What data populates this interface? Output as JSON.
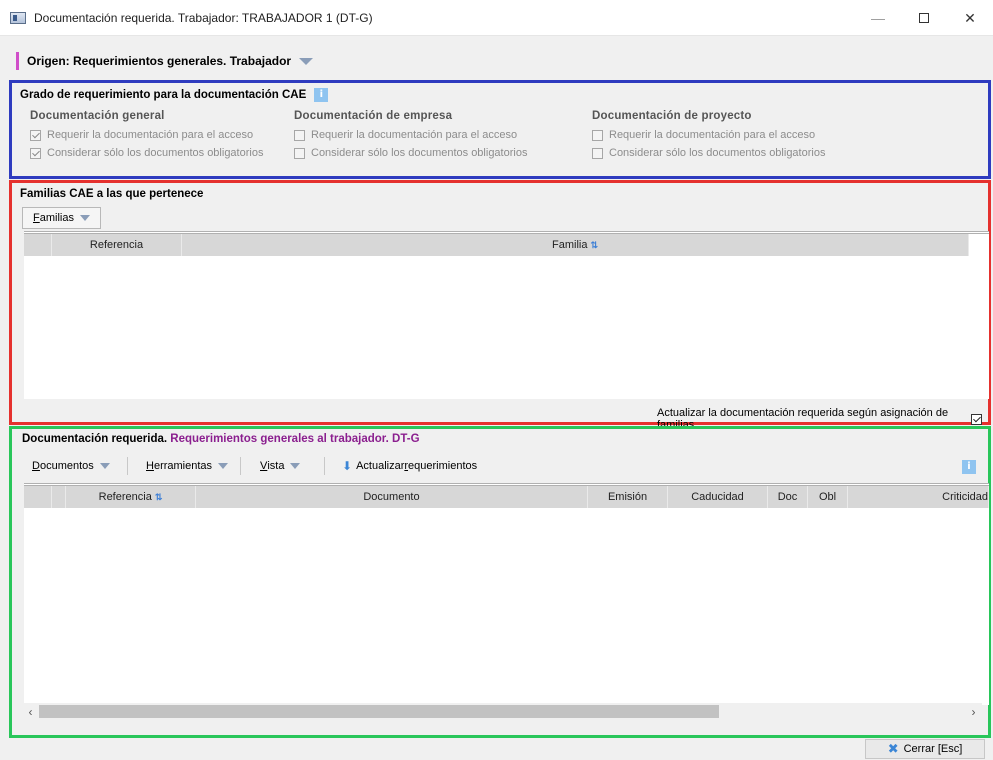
{
  "window": {
    "title": "Documentación requerida. Trabajador: TRABAJADOR 1 (DT-G)",
    "minimize": "—",
    "close": "✕"
  },
  "origin": {
    "label": "Origen: Requerimientos generales. Trabajador"
  },
  "requirement": {
    "title": "Grado de requerimiento para la documentación CAE",
    "info": "i",
    "columns": [
      {
        "heading": "Documentación general",
        "require_access": "Requerir la documentación para el acceso",
        "only_mandatory": "Considerar sólo los documentos obligatorios",
        "require_checked": true,
        "mandatory_checked": true
      },
      {
        "heading": "Documentación de empresa",
        "require_access": "Requerir la documentación para el acceso",
        "only_mandatory": "Considerar sólo los documentos obligatorios",
        "require_checked": false,
        "mandatory_checked": false
      },
      {
        "heading": "Documentación de proyecto",
        "require_access": "Requerir la documentación para el acceso",
        "only_mandatory": "Considerar sólo los documentos obligatorios",
        "require_checked": false,
        "mandatory_checked": false
      }
    ]
  },
  "families": {
    "title": "Familias CAE a las que pertenece",
    "menu_label_first": "F",
    "menu_label_rest": "amilias",
    "headers": [
      "Referencia",
      "Familia"
    ],
    "update_label": "Actualizar la documentación requerida según asignación de familias",
    "update_checked": true
  },
  "documents": {
    "title_prefix": "Documentación requerida.",
    "title_suffix": "Requerimientos generales al trabajador. DT-G",
    "menus": [
      {
        "first": "D",
        "rest": "ocumentos"
      },
      {
        "first": "H",
        "rest": "erramientas"
      },
      {
        "first": "V",
        "rest": "ista"
      }
    ],
    "update_req_before": "Actualizar ",
    "update_req_underline": "r",
    "update_req_after": "equerimientos",
    "info": "i",
    "headers": [
      "Referencia",
      "Documento",
      "Emisión",
      "Caducidad",
      "Doc",
      "Obl",
      "Criticidad"
    ],
    "scroll_left": "‹",
    "scroll_right": "›"
  },
  "footer": {
    "close_label": "Cerrar [Esc]",
    "close_icon": "✖"
  }
}
